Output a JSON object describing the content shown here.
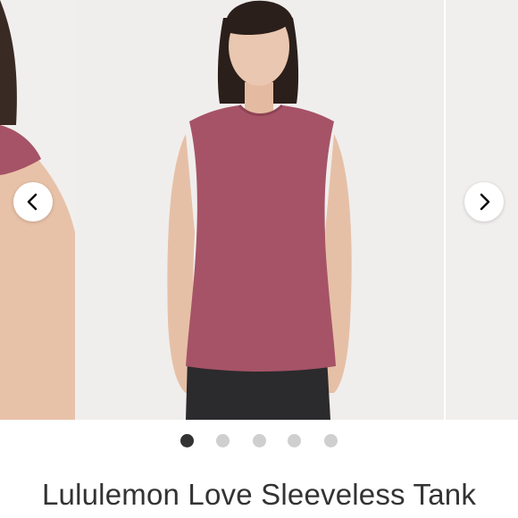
{
  "product": {
    "title": "Lululemon Love Sleeveless Tank",
    "color": "#a65367"
  },
  "carousel": {
    "prev_icon": "chevron-left-icon",
    "next_icon": "chevron-right-icon",
    "dots": 5,
    "active_dot": 1
  }
}
